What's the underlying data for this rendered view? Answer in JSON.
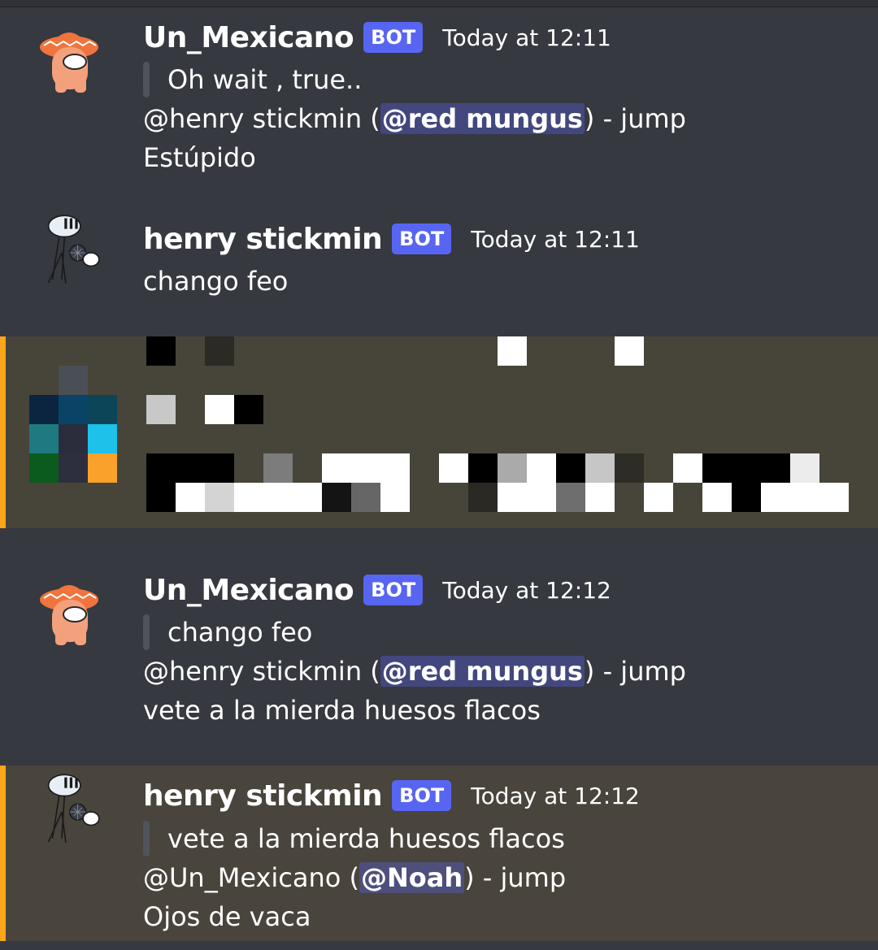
{
  "messages": [
    {
      "username": "Un_Mexicano",
      "badge": "BOT",
      "timestamp": "Today at 12:11",
      "quote": "Oh wait , true..",
      "reply_prefix": "@henry stickmin (",
      "reply_mention": "@red mungus",
      "reply_suffix": ") - jump",
      "text": "Estúpido"
    },
    {
      "username": "henry stickmin",
      "badge": "BOT",
      "timestamp": "Today at 12:11",
      "text": "chango feo"
    },
    {
      "username": "Un_Mexicano",
      "badge": "BOT",
      "timestamp": "Today at 12:12",
      "quote": "chango feo",
      "reply_prefix": "@henry stickmin (",
      "reply_mention": "@red mungus",
      "reply_suffix": ") - jump",
      "text": "vete a la mierda huesos flacos"
    },
    {
      "username": "henry stickmin",
      "badge": "BOT",
      "timestamp": "Today at 12:12",
      "quote": "vete a la mierda huesos flacos",
      "reply_prefix": "@Un_Mexicano (",
      "reply_mention": "@Noah",
      "reply_suffix": ") - jump",
      "text": "Ojos de vaca"
    }
  ],
  "icons": {
    "mexicano_avatar": "cowboy-crewmate-icon",
    "henry_avatar": "stickman-microphone-icon"
  },
  "colors": {
    "background": "#36393f",
    "highlight": "#49443c",
    "highlight_bar": "#faa61a",
    "bot_badge": "#5865f2",
    "mention_bg": "#4f5579"
  }
}
